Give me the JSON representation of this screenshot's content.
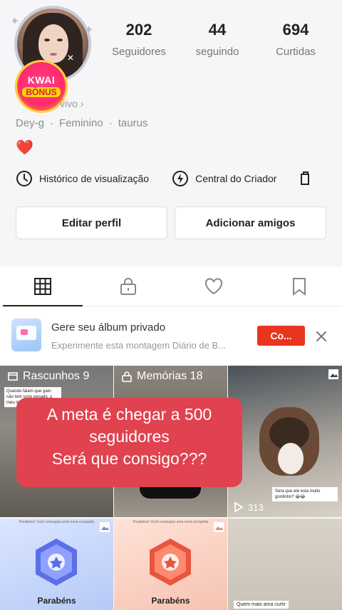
{
  "profile": {
    "avatar_icon": "profile-photo",
    "badge": {
      "line1": "KWAI",
      "line2": "BÔNUS"
    },
    "active_status": "vivo ›",
    "meta": {
      "name": "Dey-g",
      "gender": "Feminino",
      "sign": "taurus"
    },
    "bio_emoji": "❤️"
  },
  "stats": [
    {
      "value": "202",
      "label": "Seguidores"
    },
    {
      "value": "44",
      "label": "seguindo"
    },
    {
      "value": "694",
      "label": "Curtidas"
    }
  ],
  "quick_links": [
    {
      "label": "Histórico de visualização",
      "icon": "clock-icon"
    },
    {
      "label": "Central do Criador",
      "icon": "lightning-icon"
    }
  ],
  "buttons": {
    "edit": "Editar perfil",
    "add_friends": "Adicionar amigos"
  },
  "tabs": [
    {
      "name": "grid",
      "icon": "grid-icon",
      "active": true
    },
    {
      "name": "private",
      "icon": "lock-icon",
      "active": false
    },
    {
      "name": "likes",
      "icon": "heart-icon",
      "active": false
    },
    {
      "name": "saved",
      "icon": "bookmark-icon",
      "active": false
    }
  ],
  "promo": {
    "title": "Gere seu álbum privado",
    "subtitle": "Experimente esta montagem Diário de B...",
    "button": "Co..."
  },
  "grid": {
    "drafts": "Rascunhos 9",
    "memories": "Memórias 18",
    "draft_note": "Quando falam que gato não tem sono pesado, o meu dorme e ainda ronca",
    "cat_caption": "Sera que ele esta muito gordinho? 😂😂",
    "views": "313",
    "congrats_1": "Parabéns",
    "congrats_2": "Parabéns",
    "tiny_1": "Parabéns! Você conseguiu uma nova conquista",
    "tiny_2": "Parabéns! Você conseguiu uma nova conquista",
    "bottom_caption": "Quem mais ama curtir"
  },
  "overlay": {
    "line1": "A meta é chegar a 500",
    "line2": "seguidores",
    "line3": "Será que consigo???",
    "color": "#e0424f"
  },
  "colors": {
    "accent_red": "#e8351d",
    "background": "#f6f6f8"
  }
}
